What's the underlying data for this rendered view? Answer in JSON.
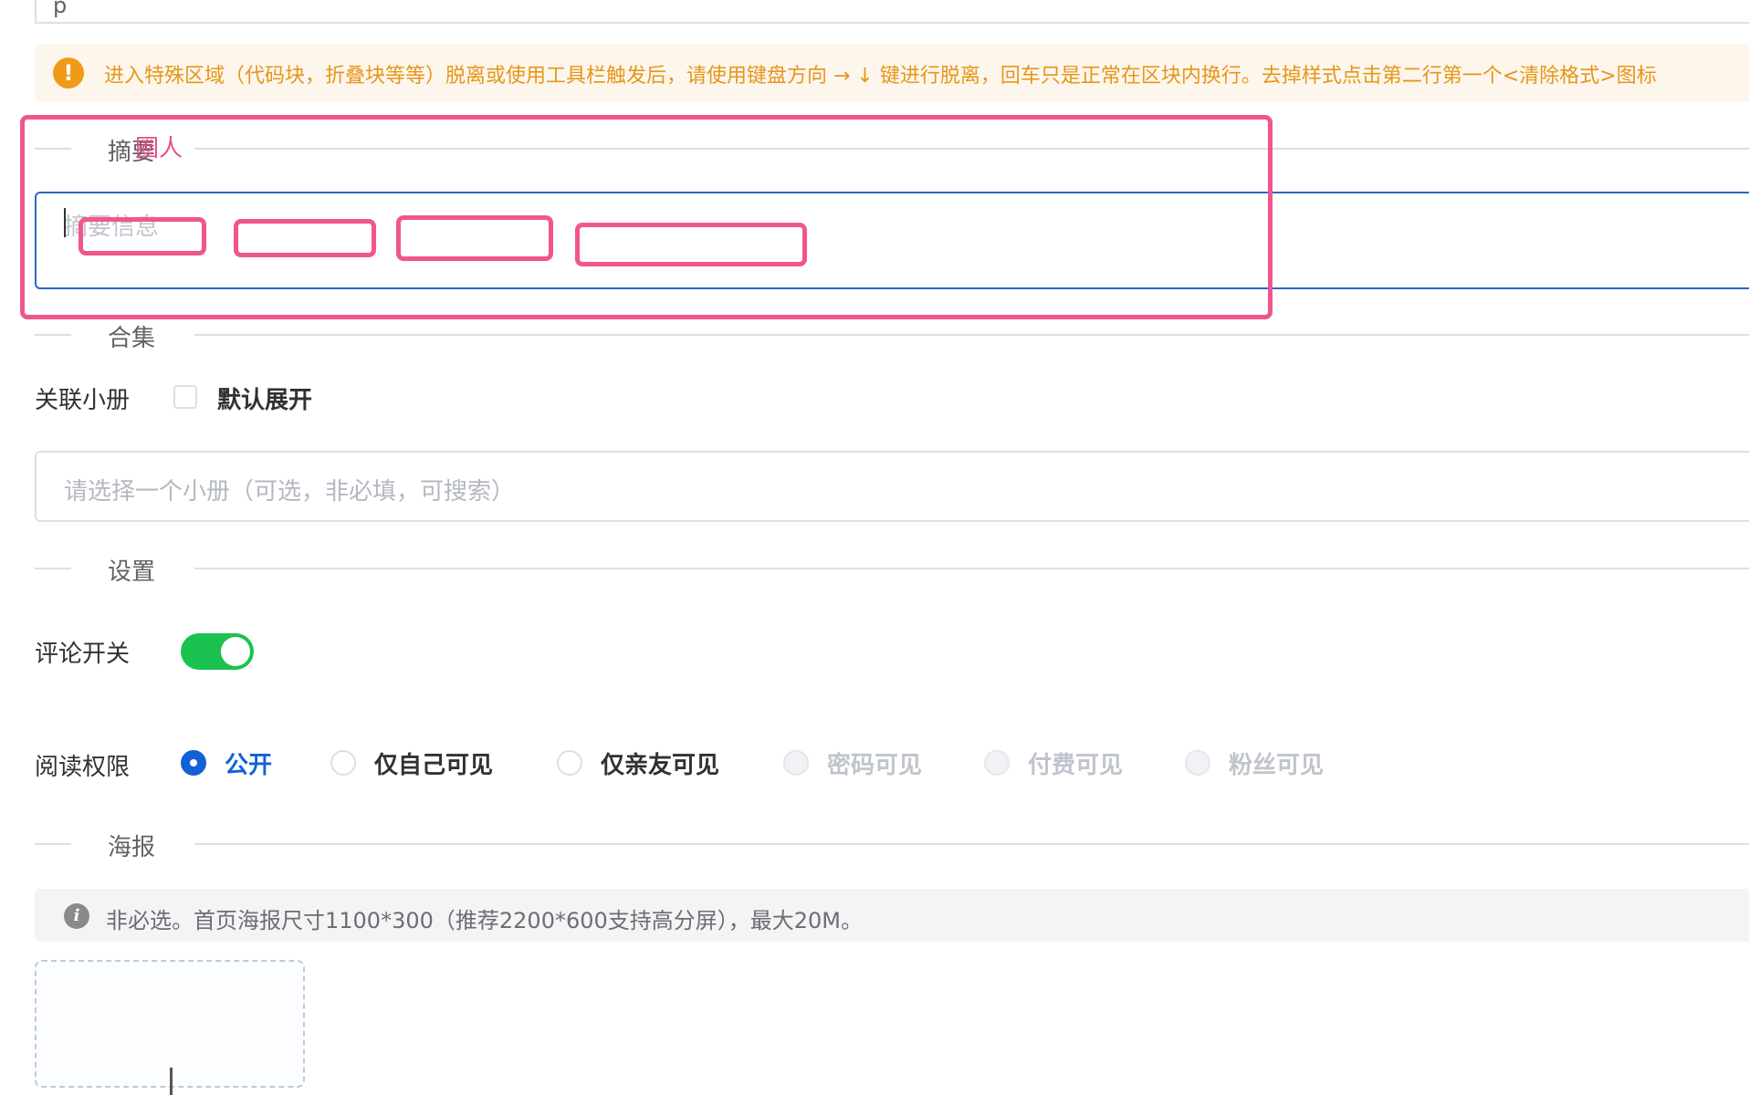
{
  "top_input": {
    "value": "p"
  },
  "warning": {
    "text": "进入特殊区域（代码块，折叠块等等）脱离或使用工具栏触发后，请使用键盘方向 → ↓ 键进行脱离，回车只是正常在区块内换行。去掉样式点击第二行第一个<清除格式>图标"
  },
  "sections": {
    "summary": "摘要",
    "collection": "合集",
    "settings": "设置",
    "poster": "海报"
  },
  "overlay_text": "圈人",
  "summary_placeholder": "摘要信息",
  "collection": {
    "label": "关联小册",
    "checkbox_label": "默认展开",
    "select_placeholder": "请选择一个小册（可选，非必填，可搜索）"
  },
  "settings": {
    "comment_label": "评论开关",
    "comment_on": true,
    "read_label": "阅读权限",
    "read_options": [
      {
        "label": "公开",
        "state": "checked"
      },
      {
        "label": "仅自己可见",
        "state": "normal"
      },
      {
        "label": "仅亲友可见",
        "state": "normal"
      },
      {
        "label": "密码可见",
        "state": "disabled"
      },
      {
        "label": "付费可见",
        "state": "disabled"
      },
      {
        "label": "粉丝可见",
        "state": "disabled"
      }
    ]
  },
  "poster": {
    "info_text": "非必选。首页海报尺寸1100*300（推荐2200*600支持高分屏），最大20M。"
  },
  "colors": {
    "warning_text": "#e6961a",
    "highlight": "#f0568d",
    "switch_on": "#1bc24f",
    "primary": "#1261d6"
  }
}
